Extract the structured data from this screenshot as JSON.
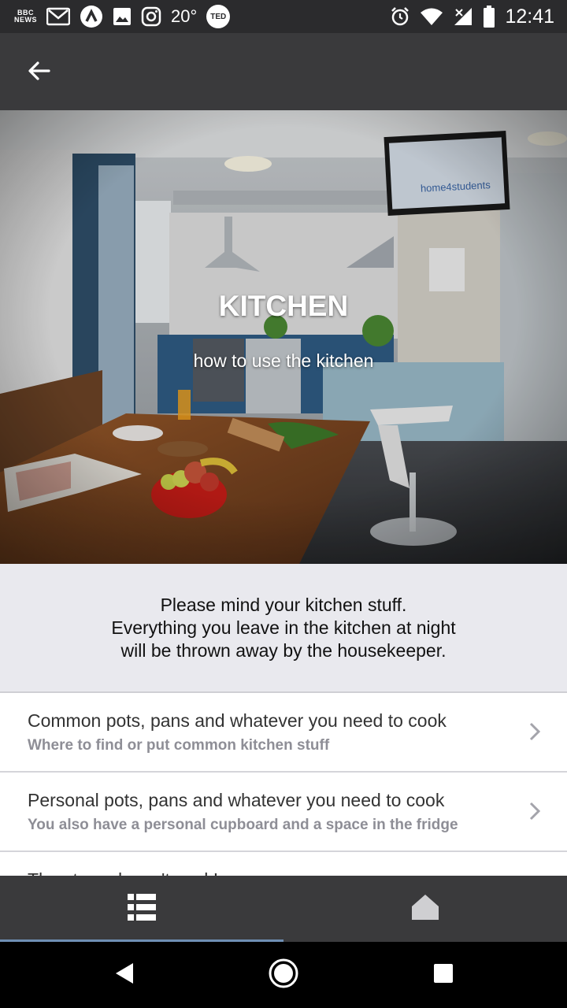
{
  "status_bar": {
    "bbc_line1": "BBC",
    "bbc_line2": "NEWS",
    "temperature": "20°",
    "ted_label": "TED",
    "time": "12:41",
    "icons": [
      "bbc-news-icon",
      "gmail-icon",
      "app-icon",
      "gallery-icon",
      "instagram-icon",
      "ted-icon",
      "alarm-icon",
      "wifi-icon",
      "signal-icon",
      "battery-icon"
    ]
  },
  "app_bar": {
    "back_icon": "arrow-left-icon"
  },
  "hero": {
    "title": "KITCHEN",
    "subtitle": "how to use the kitchen",
    "tv_brand_text": "home4students"
  },
  "notice": {
    "line1": "Please mind your kitchen stuff.",
    "line2": "Everything you leave in the kitchen at night",
    "line3": "will be thrown away by the housekeeper."
  },
  "list": {
    "items": [
      {
        "title": "Common pots, pans and whatever you need to cook",
        "subtitle": "Where to find or put common kitchen stuff"
      },
      {
        "title": "Personal pots, pans and whatever you need to cook",
        "subtitle": "You also have a personal cupboard and a space in the fridge"
      },
      {
        "title": "The stove doesn't work!",
        "subtitle": ""
      }
    ]
  },
  "tab_bar": {
    "tabs": [
      {
        "icon": "list-icon",
        "active": true
      },
      {
        "icon": "home-icon",
        "active": false
      }
    ],
    "indicator_color": "#6f8fb5"
  },
  "nav_bar": {
    "icons": [
      "nav-back-icon",
      "nav-home-icon",
      "nav-recents-icon"
    ]
  }
}
